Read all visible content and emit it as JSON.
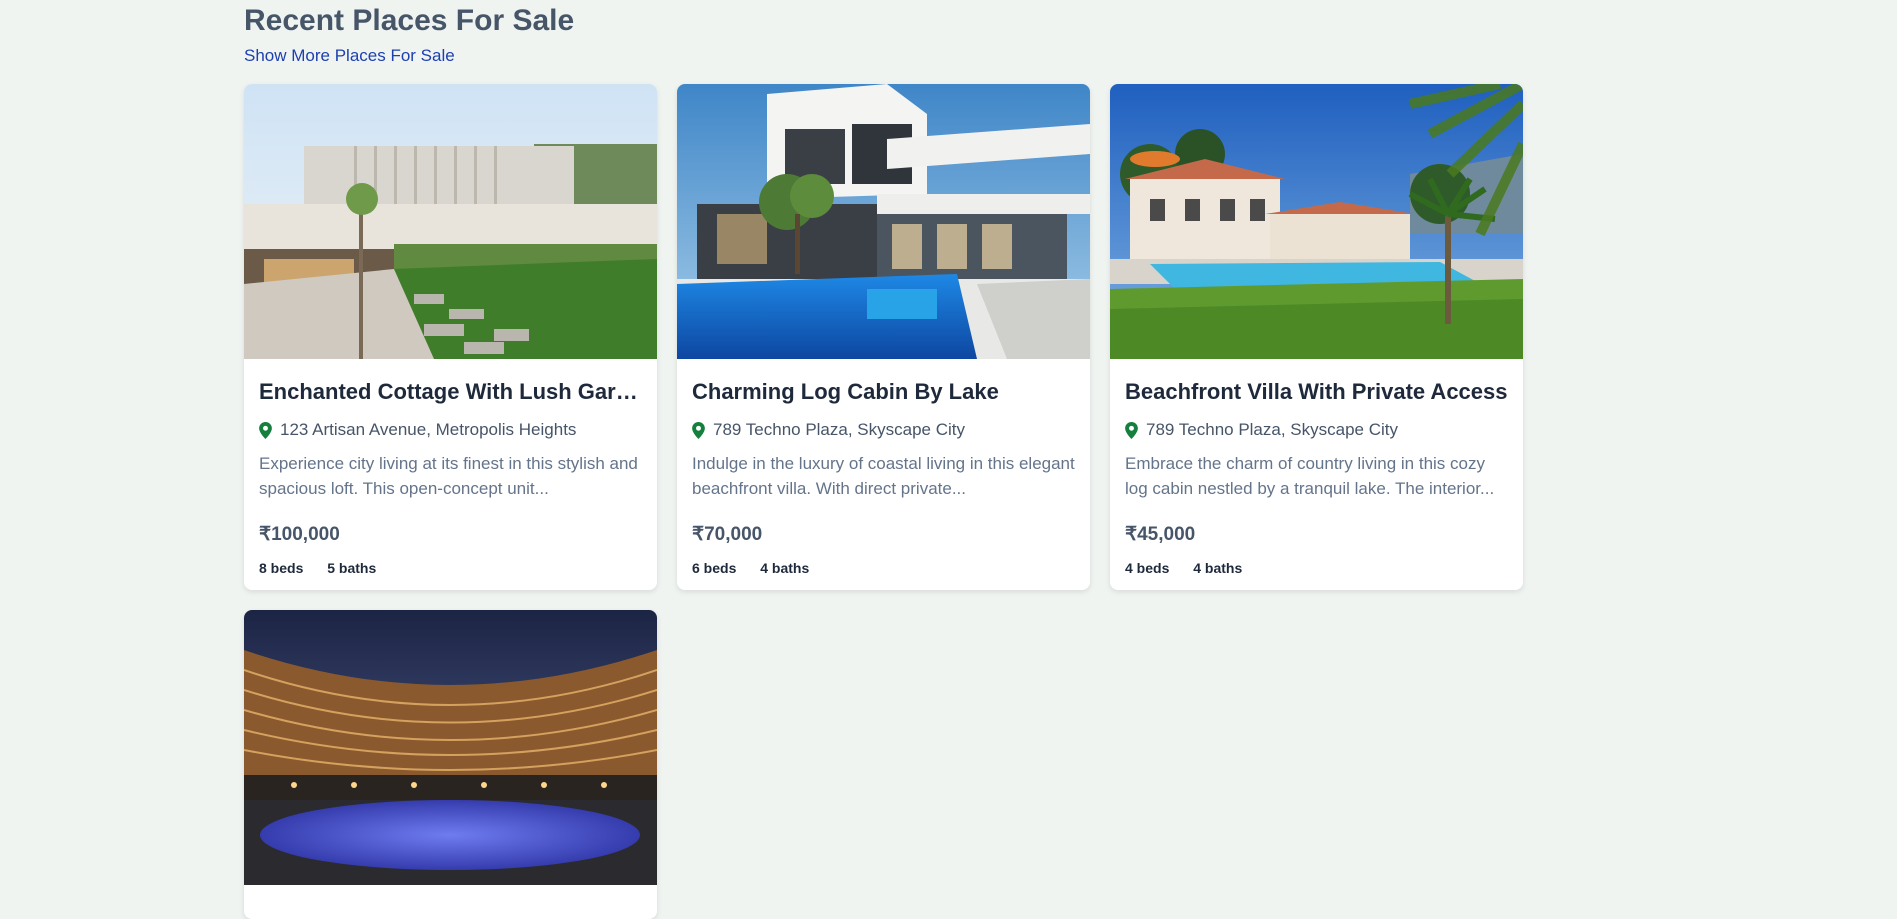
{
  "section": {
    "title": "Recent Places For Sale",
    "more_link": "Show More Places For Sale"
  },
  "listings": [
    {
      "title": "Enchanted Cottage With Lush Gard...",
      "address": "123 Artisan Avenue, Metropolis Heights",
      "description": "Experience city living at its finest in this stylish and spacious loft. This open-concept unit...",
      "price": "₹100,000",
      "beds": "8 beds",
      "baths": "5 baths"
    },
    {
      "title": "Charming Log Cabin By Lake",
      "address": "789 Techno Plaza, Skyscape City",
      "description": "Indulge in the luxury of coastal living in this elegant beachfront villa. With direct private...",
      "price": "₹70,000",
      "beds": "6 beds",
      "baths": "4 baths"
    },
    {
      "title": "Beachfront Villa With Private Access",
      "address": "789 Techno Plaza, Skyscape City",
      "description": "Embrace the charm of country living in this cozy log cabin nestled by a tranquil lake. The interior...",
      "price": "₹45,000",
      "beds": "4 beds",
      "baths": "4 baths"
    },
    {
      "title": "",
      "address": "",
      "description": "",
      "price": "",
      "beds": "",
      "baths": ""
    }
  ],
  "icons": {
    "location": "map-pin-icon"
  },
  "colors": {
    "pin": "#15803d",
    "link": "#1e40af",
    "background": "#f0f4f1"
  }
}
